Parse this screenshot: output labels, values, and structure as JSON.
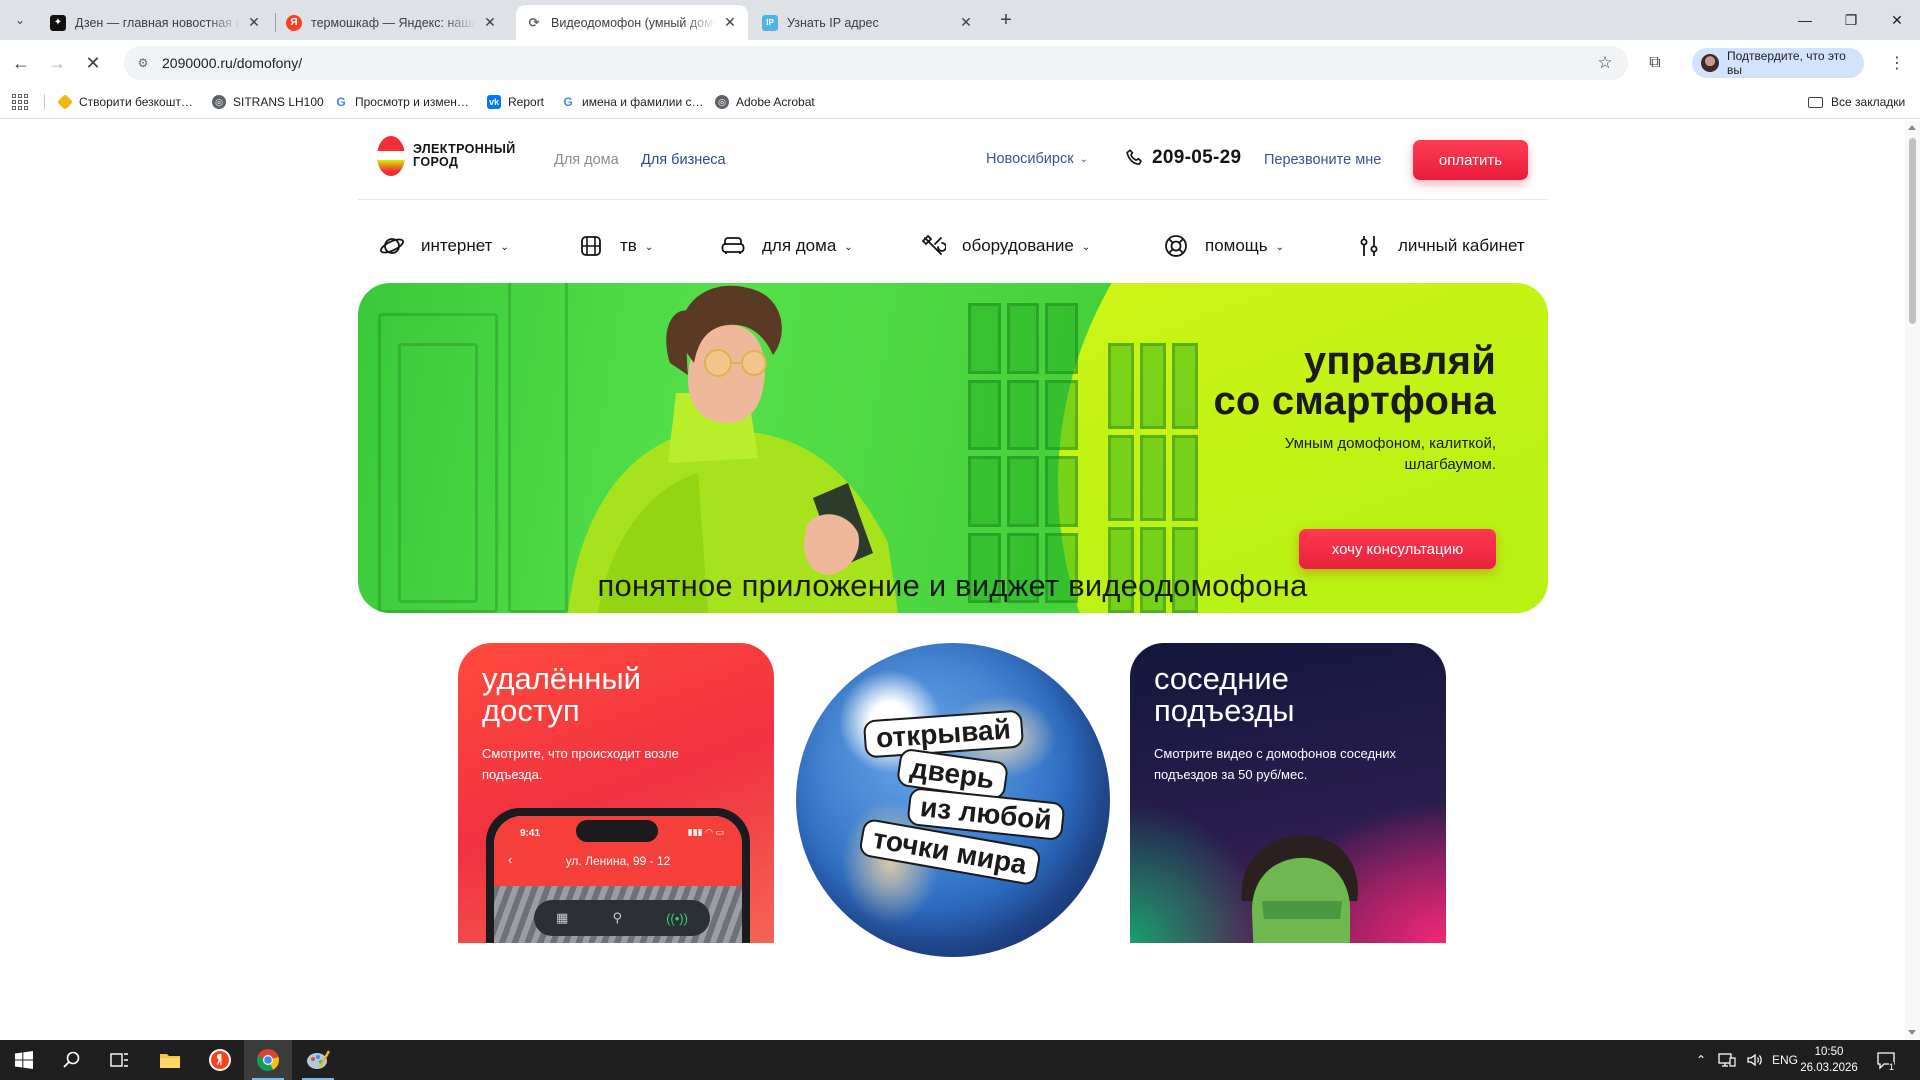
{
  "browser": {
    "tabs": [
      {
        "title": "Дзен — главная новостная ин…",
        "favicon": "dzen-icon",
        "active": false
      },
      {
        "title": "термошкаф — Яндекс: нашло…",
        "favicon": "yandex-icon",
        "active": false
      },
      {
        "title": "Видеодомофон (умный домоф…",
        "favicon": "loading-icon",
        "active": true
      },
      {
        "title": "Узнать IP адрес",
        "favicon": "ip-icon",
        "active": false
      }
    ],
    "url": "2090000.ru/domofony/",
    "profile_label": "Подтвердите, что это вы",
    "bookmarks": [
      {
        "label": "Створити безкошт…",
        "icon": "binance-icon"
      },
      {
        "label": "SITRANS LH100",
        "icon": "globe-icon"
      },
      {
        "label": "Просмотр и измен…",
        "icon": "google-icon"
      },
      {
        "label": "Report",
        "icon": "vk-icon"
      },
      {
        "label": "имена и фамилии с…",
        "icon": "google-icon"
      },
      {
        "label": "Adobe Acrobat",
        "icon": "globe-icon"
      }
    ],
    "all_bookmarks": "Все закладки"
  },
  "site": {
    "logo_text": "ЭЛЕКТРОННЫЙ ГОРОД",
    "segments": {
      "home": "Для дома",
      "business": "Для бизнеса"
    },
    "city": "Новосибирск",
    "phone": "209-05-29",
    "callback": "Перезвоните мне",
    "pay_button": "оплатить",
    "menu": [
      {
        "label": "интернет",
        "icon": "planet-icon"
      },
      {
        "label": "тв",
        "icon": "tv-icon"
      },
      {
        "label": "для дома",
        "icon": "sofa-icon"
      },
      {
        "label": "оборудование",
        "icon": "tools-icon"
      },
      {
        "label": "помощь",
        "icon": "lifebuoy-icon"
      },
      {
        "label": "личный кабинет",
        "icon": "sliders-icon"
      }
    ],
    "hero": {
      "title_line1": "управляй",
      "title_line2": "со смартфона",
      "subtitle": "Умным домофоном, калиткой, шлагбаумом.",
      "button": "хочу консультацию"
    },
    "section_title": "понятное приложение и виджет видеодомофона",
    "cards": [
      {
        "title_line1": "удалённый",
        "title_line2": "доступ",
        "text": "Смотрите, что происходит возле подъезда."
      },
      {
        "stickers": [
          "открывай",
          "дверь",
          "из любой",
          "точки мира"
        ]
      },
      {
        "title_line1": "соседние",
        "title_line2": "подъезды",
        "text": "Смотрите видео с домофонов соседних подъездов за 50 руб/мес."
      }
    ],
    "phone_mock": {
      "time": "9:41",
      "address": "ул. Ленина, 99 - 12"
    }
  },
  "taskbar": {
    "language": "ENG",
    "time": "10:50",
    "date": "26.03.2026",
    "notifications": "1"
  }
}
